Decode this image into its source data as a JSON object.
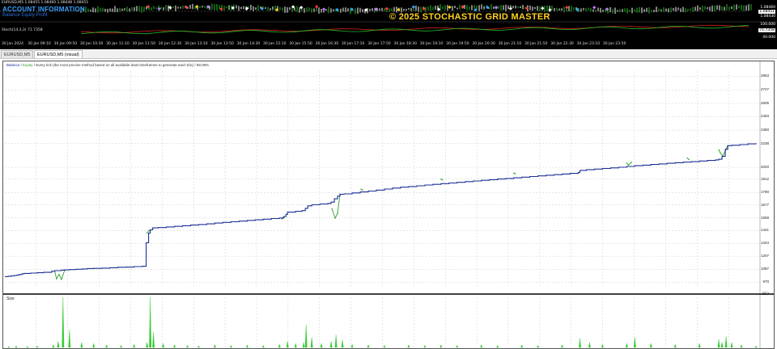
{
  "price_panel": {
    "symbol_line": "EURUSD,M5  1.08455 1.08460 1.08448 1.08451",
    "account_title": "ACCOUNT INFORMATION",
    "account_sub": "Balance  Equity  Profit",
    "indicator_line": "Stoch(14,3,3) 71.7358",
    "brand": "© 2025 STOCHASTIC GRID MASTER",
    "scale": [
      "1.08460",
      "1.08451",
      "1.08430",
      "100.000",
      "71.7358",
      "40.000"
    ],
    "colors": {
      "background": "#000000",
      "brand": "#ffd21e",
      "account": "#3aa0ff",
      "stoch_red": "#d62020",
      "stoch_green": "#25c025"
    }
  },
  "time_axis": {
    "labels": [
      "30 Jan 2024",
      "30 Jan 09:10",
      "30 Jan 09:50",
      "30 Jan 10:30",
      "30 Jan 11:10",
      "30 Jan 11:50",
      "30 Jan 12:30",
      "30 Jan 13:10",
      "30 Jan 13:50",
      "30 Jan 14:30",
      "30 Jan 15:10",
      "30 Jan 15:50",
      "30 Jan 16:30",
      "30 Jan 17:10",
      "30 Jan 17:50",
      "30 Jan 18:30",
      "30 Jan 19:10",
      "30 Jan 19:50",
      "30 Jan 20:30",
      "30 Jan 21:10",
      "30 Jan 21:50",
      "30 Jan 22:30",
      "30 Jan 23:10",
      "30 Jan 23:50"
    ]
  },
  "tabs": [
    {
      "label": "EURUSD,M5",
      "active": false
    },
    {
      "label": "EURUSD,M5 (visual)",
      "active": true
    }
  ],
  "report": {
    "legend_balance": "Balance",
    "legend_equity": "Equity",
    "legend_rest": "/ Every tick (the most precise method based on all available least timeframes to generate each tick) / 98.09%",
    "size_label": "Size",
    "size_axis": "352"
  },
  "chart_data": {
    "type": "line",
    "title": "",
    "y_ticks": [
      2853,
      2727,
      2605,
      2483,
      2360,
      2238,
      2020,
      1912,
      1790,
      1677,
      1559,
      1441,
      1323,
      1207,
      1087,
      970
    ],
    "ylim": [
      920,
      2900
    ],
    "grid": true,
    "n_bars": 24,
    "colors": {
      "balance": "#1a2f95",
      "equity": "#2ca02c",
      "size": "#33cc33"
    },
    "series": [
      {
        "name": "Balance",
        "x": [
          0,
          4,
          8,
          12,
          15,
          18,
          21,
          22,
          24,
          32,
          40,
          48,
          58,
          62,
          70,
          74,
          80,
          88,
          96,
          102,
          110,
          120,
          130,
          140,
          150,
          160,
          170,
          175,
          178,
          180,
          183,
          190,
          200,
          210,
          220,
          230,
          240,
          250,
          260,
          270,
          280,
          290,
          300,
          310,
          320,
          330,
          340,
          345,
          348,
          350,
          360,
          368,
          372,
          375,
          380,
          390,
          400,
          404,
          408,
          412,
          415,
          420,
          430,
          440,
          450,
          460,
          470,
          480,
          490,
          500,
          510,
          520,
          530,
          540,
          550,
          560,
          570,
          580,
          590,
          600,
          610,
          620,
          630,
          640,
          650,
          660,
          670,
          680,
          690,
          700,
          710,
          712,
          720,
          730,
          740,
          750,
          760,
          770,
          780,
          790,
          800,
          810,
          820,
          830,
          840,
          850,
          860,
          870,
          880,
          884,
          888,
          892,
          895,
          900,
          910,
          920,
          930
        ],
        "y": [
          1020,
          1024,
          1028,
          1031,
          1035,
          1040,
          1044,
          1047,
          1050,
          1053,
          1056,
          1060,
          1070,
          1075,
          1080,
          1082,
          1085,
          1088,
          1091,
          1094,
          1096,
          1098,
          1102,
          1106,
          1108,
          1112,
          1115,
          1330,
          1418,
          1448,
          1466,
          1469,
          1475,
          1480,
          1486,
          1492,
          1497,
          1503,
          1510,
          1516,
          1522,
          1528,
          1535,
          1540,
          1546,
          1552,
          1557,
          1570,
          1590,
          1610,
          1618,
          1624,
          1645,
          1668,
          1677,
          1685,
          1690,
          1702,
          1732,
          1757,
          1773,
          1777,
          1786,
          1795,
          1803,
          1812,
          1821,
          1830,
          1838,
          1844,
          1851,
          1858,
          1864,
          1871,
          1877,
          1883,
          1889,
          1895,
          1901,
          1907,
          1913,
          1918,
          1924,
          1930,
          1936,
          1942,
          1948,
          1953,
          1959,
          1965,
          1972,
          1992,
          1998,
          2004,
          2010,
          2015,
          2021,
          2028,
          2035,
          2040,
          2046,
          2051,
          2057,
          2062,
          2067,
          2072,
          2078,
          2083,
          2088,
          2094,
          2120,
          2185,
          2218,
          2222,
          2228,
          2234,
          2240
        ]
      },
      {
        "name": "Equity",
        "x": [
          62,
          64,
          67,
          70,
          74,
          176,
          179,
          343,
          346,
          405,
          409,
          412,
          415,
          441,
          443,
          540,
          542,
          630,
          632,
          770,
          772,
          776,
          845,
          847,
          884,
          886,
          889,
          892,
          895
        ],
        "y": [
          1060,
          1000,
          1040,
          995,
          1078,
          1420,
          1445,
          1548,
          1560,
          1640,
          1555,
          1600,
          1777,
          1820,
          1812,
          1912,
          1904,
          1968,
          1960,
          2060,
          2040,
          2066,
          2105,
          2090,
          2180,
          2150,
          2125,
          2170,
          2218
        ]
      },
      {
        "name": "Size",
        "x": [
          5,
          14,
          28,
          40,
          60,
          66,
          72,
          80,
          95,
          110,
          126,
          144,
          160,
          176,
          180,
          184,
          196,
          210,
          226,
          240,
          260,
          280,
          300,
          320,
          340,
          350,
          360,
          370,
          373,
          380,
          392,
          404,
          410,
          418,
          430,
          450,
          470,
          500,
          520,
          540,
          560,
          590,
          610,
          640,
          660,
          690,
          712,
          724,
          740,
          770,
          780,
          800,
          830,
          860,
          884,
          888,
          893,
          900,
          912,
          930
        ],
        "y": [
          0.02,
          0.03,
          0.02,
          0.03,
          0.05,
          0.12,
          1.0,
          0.35,
          0.1,
          0.08,
          0.05,
          0.04,
          0.06,
          0.1,
          1.0,
          0.3,
          0.08,
          0.05,
          0.04,
          0.03,
          0.05,
          0.04,
          0.05,
          0.04,
          0.06,
          0.12,
          0.08,
          0.1,
          0.45,
          0.2,
          0.08,
          0.12,
          0.25,
          0.15,
          0.06,
          0.05,
          0.04,
          0.05,
          0.04,
          0.05,
          0.04,
          0.05,
          0.04,
          0.05,
          0.04,
          0.05,
          0.18,
          0.1,
          0.06,
          0.08,
          0.2,
          0.08,
          0.06,
          0.08,
          0.16,
          0.1,
          0.22,
          0.1,
          0.05,
          0.03
        ]
      }
    ]
  }
}
